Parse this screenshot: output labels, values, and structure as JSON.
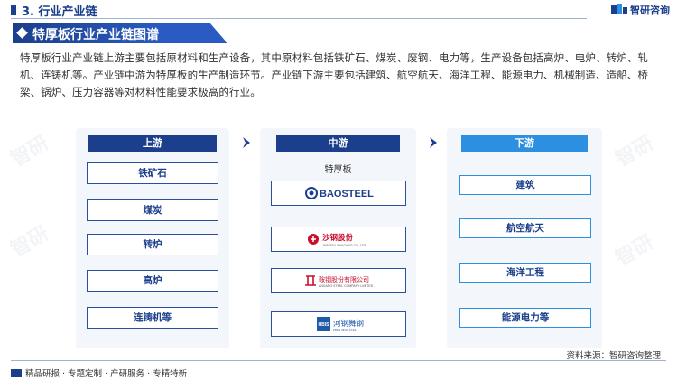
{
  "header": {
    "section_title": "3. 行业产业链",
    "brand": "智研咨询",
    "chart_title": "特厚板行业产业链图谱"
  },
  "intro": "特厚板行业产业链上游主要包括原材料和生产设备，其中原材料包括铁矿石、煤炭、废钢、电力等，生产设备包括高炉、电炉、转炉、轧机、连铸机等。产业链中游为特厚板的生产制造环节。产业链下游主要包括建筑、航空航天、海洋工程、能源电力、机械制造、造船、桥梁、锅炉、压力容器等对材料性能要求极高的行业。",
  "upstream": {
    "title": "上游",
    "items": [
      "铁矿石",
      "煤炭",
      "转炉",
      "高炉",
      "连铸机等"
    ]
  },
  "midstream": {
    "title": "中游",
    "label": "特厚板",
    "companies": [
      {
        "name": "BAOSTEEL",
        "icon": "baosteel-logo"
      },
      {
        "name": "沙钢股份",
        "sub": "JIANGSU SHAGANG CO.,LTD",
        "icon": "shagang-logo"
      },
      {
        "name": "鞍钢股份有限公司",
        "sub": "ANGANG STEEL COMPANY LIMITED",
        "icon": "angang-logo"
      },
      {
        "name": "河钢舞钢",
        "abbr": "HBIS",
        "sub": "HBIS WUSTEEL",
        "icon": "hbis-logo"
      }
    ]
  },
  "downstream": {
    "title": "下游",
    "items": [
      "建筑",
      "航空航天",
      "海洋工程",
      "能源电力等"
    ]
  },
  "footer": {
    "slogan": "精品研报 · 专题定制 · 产研服务 · 专精特新",
    "source": "资料来源：智研咨询整理"
  },
  "colors": {
    "primary": "#1b3f8c",
    "accent": "#2d8fe0"
  }
}
